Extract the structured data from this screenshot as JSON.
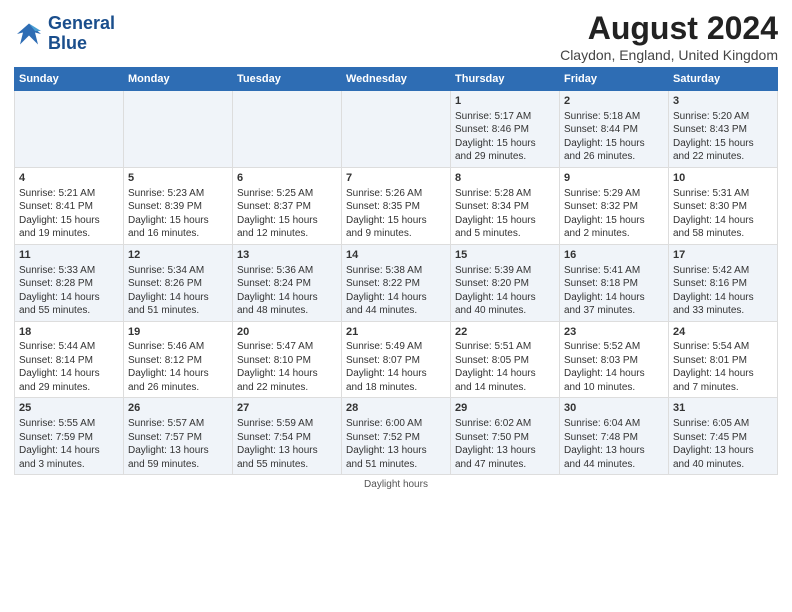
{
  "logo": {
    "line1": "General",
    "line2": "Blue"
  },
  "title": "August 2024",
  "location": "Claydon, England, United Kingdom",
  "days_header": [
    "Sunday",
    "Monday",
    "Tuesday",
    "Wednesday",
    "Thursday",
    "Friday",
    "Saturday"
  ],
  "footer": "Daylight hours",
  "weeks": [
    [
      {
        "day": "",
        "info": ""
      },
      {
        "day": "",
        "info": ""
      },
      {
        "day": "",
        "info": ""
      },
      {
        "day": "",
        "info": ""
      },
      {
        "day": "1",
        "info": "Sunrise: 5:17 AM\nSunset: 8:46 PM\nDaylight: 15 hours\nand 29 minutes."
      },
      {
        "day": "2",
        "info": "Sunrise: 5:18 AM\nSunset: 8:44 PM\nDaylight: 15 hours\nand 26 minutes."
      },
      {
        "day": "3",
        "info": "Sunrise: 5:20 AM\nSunset: 8:43 PM\nDaylight: 15 hours\nand 22 minutes."
      }
    ],
    [
      {
        "day": "4",
        "info": "Sunrise: 5:21 AM\nSunset: 8:41 PM\nDaylight: 15 hours\nand 19 minutes."
      },
      {
        "day": "5",
        "info": "Sunrise: 5:23 AM\nSunset: 8:39 PM\nDaylight: 15 hours\nand 16 minutes."
      },
      {
        "day": "6",
        "info": "Sunrise: 5:25 AM\nSunset: 8:37 PM\nDaylight: 15 hours\nand 12 minutes."
      },
      {
        "day": "7",
        "info": "Sunrise: 5:26 AM\nSunset: 8:35 PM\nDaylight: 15 hours\nand 9 minutes."
      },
      {
        "day": "8",
        "info": "Sunrise: 5:28 AM\nSunset: 8:34 PM\nDaylight: 15 hours\nand 5 minutes."
      },
      {
        "day": "9",
        "info": "Sunrise: 5:29 AM\nSunset: 8:32 PM\nDaylight: 15 hours\nand 2 minutes."
      },
      {
        "day": "10",
        "info": "Sunrise: 5:31 AM\nSunset: 8:30 PM\nDaylight: 14 hours\nand 58 minutes."
      }
    ],
    [
      {
        "day": "11",
        "info": "Sunrise: 5:33 AM\nSunset: 8:28 PM\nDaylight: 14 hours\nand 55 minutes."
      },
      {
        "day": "12",
        "info": "Sunrise: 5:34 AM\nSunset: 8:26 PM\nDaylight: 14 hours\nand 51 minutes."
      },
      {
        "day": "13",
        "info": "Sunrise: 5:36 AM\nSunset: 8:24 PM\nDaylight: 14 hours\nand 48 minutes."
      },
      {
        "day": "14",
        "info": "Sunrise: 5:38 AM\nSunset: 8:22 PM\nDaylight: 14 hours\nand 44 minutes."
      },
      {
        "day": "15",
        "info": "Sunrise: 5:39 AM\nSunset: 8:20 PM\nDaylight: 14 hours\nand 40 minutes."
      },
      {
        "day": "16",
        "info": "Sunrise: 5:41 AM\nSunset: 8:18 PM\nDaylight: 14 hours\nand 37 minutes."
      },
      {
        "day": "17",
        "info": "Sunrise: 5:42 AM\nSunset: 8:16 PM\nDaylight: 14 hours\nand 33 minutes."
      }
    ],
    [
      {
        "day": "18",
        "info": "Sunrise: 5:44 AM\nSunset: 8:14 PM\nDaylight: 14 hours\nand 29 minutes."
      },
      {
        "day": "19",
        "info": "Sunrise: 5:46 AM\nSunset: 8:12 PM\nDaylight: 14 hours\nand 26 minutes."
      },
      {
        "day": "20",
        "info": "Sunrise: 5:47 AM\nSunset: 8:10 PM\nDaylight: 14 hours\nand 22 minutes."
      },
      {
        "day": "21",
        "info": "Sunrise: 5:49 AM\nSunset: 8:07 PM\nDaylight: 14 hours\nand 18 minutes."
      },
      {
        "day": "22",
        "info": "Sunrise: 5:51 AM\nSunset: 8:05 PM\nDaylight: 14 hours\nand 14 minutes."
      },
      {
        "day": "23",
        "info": "Sunrise: 5:52 AM\nSunset: 8:03 PM\nDaylight: 14 hours\nand 10 minutes."
      },
      {
        "day": "24",
        "info": "Sunrise: 5:54 AM\nSunset: 8:01 PM\nDaylight: 14 hours\nand 7 minutes."
      }
    ],
    [
      {
        "day": "25",
        "info": "Sunrise: 5:55 AM\nSunset: 7:59 PM\nDaylight: 14 hours\nand 3 minutes."
      },
      {
        "day": "26",
        "info": "Sunrise: 5:57 AM\nSunset: 7:57 PM\nDaylight: 13 hours\nand 59 minutes."
      },
      {
        "day": "27",
        "info": "Sunrise: 5:59 AM\nSunset: 7:54 PM\nDaylight: 13 hours\nand 55 minutes."
      },
      {
        "day": "28",
        "info": "Sunrise: 6:00 AM\nSunset: 7:52 PM\nDaylight: 13 hours\nand 51 minutes."
      },
      {
        "day": "29",
        "info": "Sunrise: 6:02 AM\nSunset: 7:50 PM\nDaylight: 13 hours\nand 47 minutes."
      },
      {
        "day": "30",
        "info": "Sunrise: 6:04 AM\nSunset: 7:48 PM\nDaylight: 13 hours\nand 44 minutes."
      },
      {
        "day": "31",
        "info": "Sunrise: 6:05 AM\nSunset: 7:45 PM\nDaylight: 13 hours\nand 40 minutes."
      }
    ]
  ]
}
